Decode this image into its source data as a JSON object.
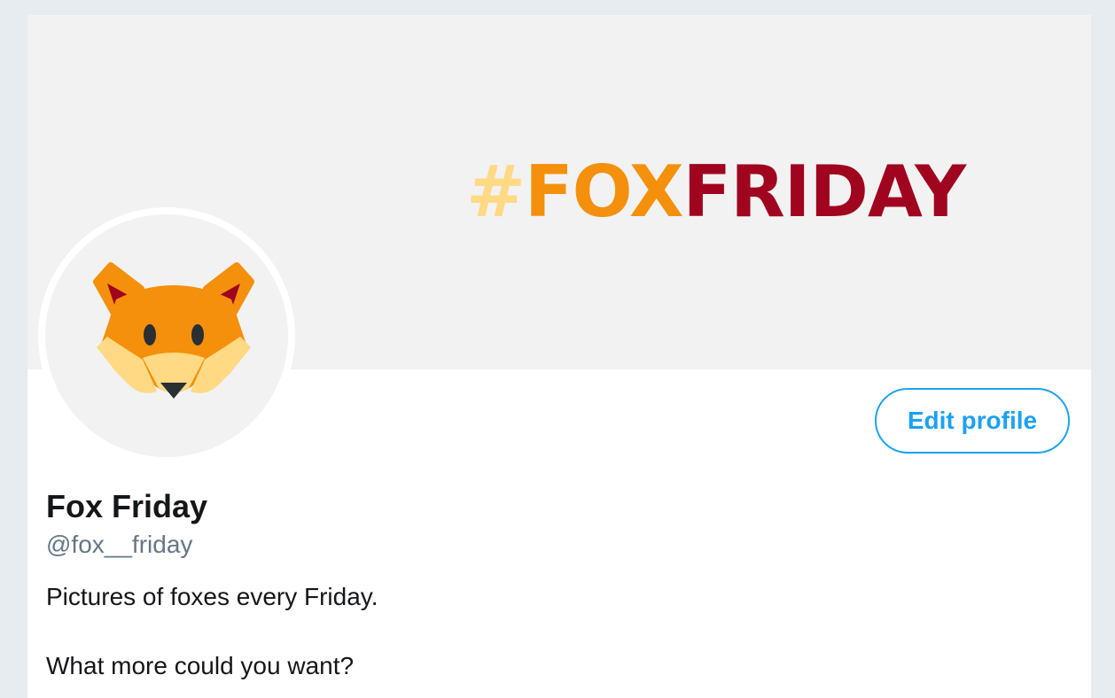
{
  "banner": {
    "hash": "#",
    "fox": "FOX",
    "friday": "FRIDAY",
    "colors": {
      "hash": "#ffd983",
      "fox": "#f4900c",
      "friday": "#a0041e"
    }
  },
  "avatar": {
    "icon": "fox-face-icon"
  },
  "profile": {
    "edit_label": "Edit profile",
    "name": "Fox Friday",
    "handle": "@fox__friday",
    "bio_lines": [
      "Pictures of foxes every Friday.",
      "What more could you want?"
    ]
  },
  "colors": {
    "accent": "#1da1f2",
    "text": "#14171a",
    "muted": "#657786"
  }
}
